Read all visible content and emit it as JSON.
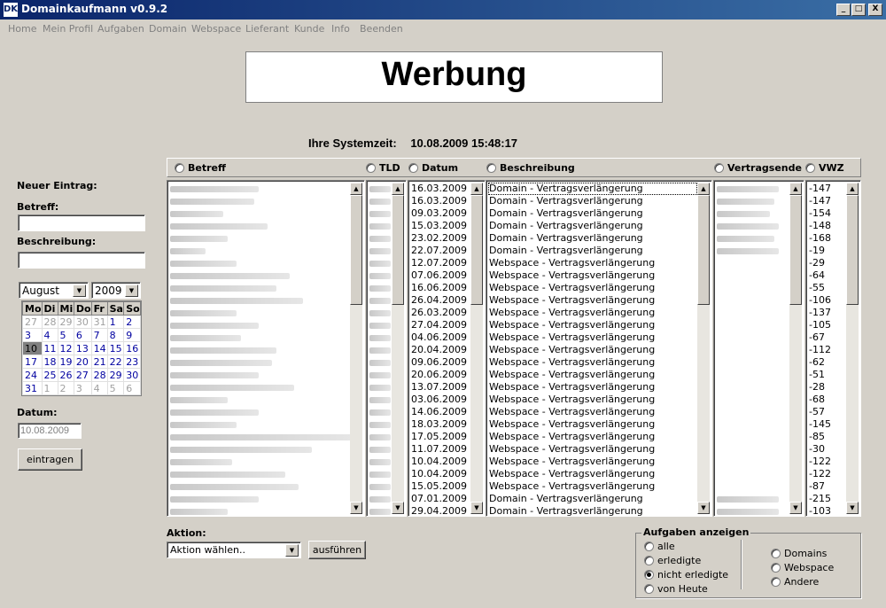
{
  "window": {
    "app_icon": "DK",
    "title": "Domainkaufmann v0.9.2",
    "minimize_glyph": "_",
    "maximize_glyph": "□",
    "close_glyph": "X"
  },
  "menu": [
    "Home",
    "Mein Profil",
    "Aufgaben",
    "Domain",
    "Webspace",
    "Lieferant",
    "Kunde",
    "Info",
    "Beenden"
  ],
  "ad": {
    "text": "Werbung"
  },
  "system_time": {
    "label": "Ihre Systemzeit:",
    "value": "10.08.2009 15:48:17"
  },
  "new_entry": {
    "heading": "Neuer Eintrag:",
    "betreff_label": "Betreff:",
    "betreff_value": "",
    "beschreibung_label": "Beschreibung:",
    "beschreibung_value": "",
    "month": "August",
    "year": "2009",
    "datum_label": "Datum:",
    "datum_value": "10.08.2009",
    "submit_label": "eintragen"
  },
  "calendar": {
    "weekdays": [
      "Mo",
      "Di",
      "Mi",
      "Do",
      "Fr",
      "Sa",
      "So"
    ],
    "weeks": [
      [
        {
          "d": "27",
          "t": "other"
        },
        {
          "d": "28",
          "t": "other"
        },
        {
          "d": "29",
          "t": "other"
        },
        {
          "d": "30",
          "t": "other"
        },
        {
          "d": "31",
          "t": "other"
        },
        {
          "d": "1",
          "t": "cur"
        },
        {
          "d": "2",
          "t": "cur"
        }
      ],
      [
        {
          "d": "3",
          "t": "cur"
        },
        {
          "d": "4",
          "t": "cur"
        },
        {
          "d": "5",
          "t": "cur"
        },
        {
          "d": "6",
          "t": "cur"
        },
        {
          "d": "7",
          "t": "cur"
        },
        {
          "d": "8",
          "t": "cur"
        },
        {
          "d": "9",
          "t": "cur"
        }
      ],
      [
        {
          "d": "10",
          "t": "today"
        },
        {
          "d": "11",
          "t": "cur"
        },
        {
          "d": "12",
          "t": "cur"
        },
        {
          "d": "13",
          "t": "cur"
        },
        {
          "d": "14",
          "t": "cur"
        },
        {
          "d": "15",
          "t": "cur"
        },
        {
          "d": "16",
          "t": "cur"
        }
      ],
      [
        {
          "d": "17",
          "t": "cur"
        },
        {
          "d": "18",
          "t": "cur"
        },
        {
          "d": "19",
          "t": "cur"
        },
        {
          "d": "20",
          "t": "cur"
        },
        {
          "d": "21",
          "t": "cur"
        },
        {
          "d": "22",
          "t": "cur"
        },
        {
          "d": "23",
          "t": "cur"
        }
      ],
      [
        {
          "d": "24",
          "t": "cur"
        },
        {
          "d": "25",
          "t": "cur"
        },
        {
          "d": "26",
          "t": "cur"
        },
        {
          "d": "27",
          "t": "cur"
        },
        {
          "d": "28",
          "t": "cur"
        },
        {
          "d": "29",
          "t": "cur"
        },
        {
          "d": "30",
          "t": "cur"
        }
      ],
      [
        {
          "d": "31",
          "t": "cur"
        },
        {
          "d": "1",
          "t": "other"
        },
        {
          "d": "2",
          "t": "other"
        },
        {
          "d": "3",
          "t": "other"
        },
        {
          "d": "4",
          "t": "other"
        },
        {
          "d": "5",
          "t": "other"
        },
        {
          "d": "6",
          "t": "other"
        }
      ]
    ]
  },
  "columns": {
    "betreff": "Betreff",
    "tld": "TLD",
    "datum": "Datum",
    "beschreibung": "Beschreibung",
    "vertragsende": "Vertragsende",
    "vwz": "VWZ"
  },
  "scroll_glyphs": {
    "up": "▲",
    "down": "▼"
  },
  "tasks": [
    {
      "datum": "16.03.2009",
      "beschreibung": "Domain - Vertragsverlängerung",
      "vwz": "-147"
    },
    {
      "datum": "16.03.2009",
      "beschreibung": "Domain - Vertragsverlängerung",
      "vwz": "-147"
    },
    {
      "datum": "09.03.2009",
      "beschreibung": "Domain - Vertragsverlängerung",
      "vwz": "-154"
    },
    {
      "datum": "15.03.2009",
      "beschreibung": "Domain - Vertragsverlängerung",
      "vwz": "-148"
    },
    {
      "datum": "23.02.2009",
      "beschreibung": "Domain - Vertragsverlängerung",
      "vwz": "-168"
    },
    {
      "datum": "22.07.2009",
      "beschreibung": "Domain - Vertragsverlängerung",
      "vwz": "-19"
    },
    {
      "datum": "12.07.2009",
      "beschreibung": "Webspace - Vertragsverlängerung",
      "vwz": "-29"
    },
    {
      "datum": "07.06.2009",
      "beschreibung": "Webspace - Vertragsverlängerung",
      "vwz": "-64"
    },
    {
      "datum": "16.06.2009",
      "beschreibung": "Webspace - Vertragsverlängerung",
      "vwz": "-55"
    },
    {
      "datum": "26.04.2009",
      "beschreibung": "Webspace - Vertragsverlängerung",
      "vwz": "-106"
    },
    {
      "datum": "26.03.2009",
      "beschreibung": "Webspace - Vertragsverlängerung",
      "vwz": "-137"
    },
    {
      "datum": "27.04.2009",
      "beschreibung": "Webspace - Vertragsverlängerung",
      "vwz": "-105"
    },
    {
      "datum": "04.06.2009",
      "beschreibung": "Webspace - Vertragsverlängerung",
      "vwz": "-67"
    },
    {
      "datum": "20.04.2009",
      "beschreibung": "Webspace - Vertragsverlängerung",
      "vwz": "-112"
    },
    {
      "datum": "09.06.2009",
      "beschreibung": "Webspace - Vertragsverlängerung",
      "vwz": "-62"
    },
    {
      "datum": "20.06.2009",
      "beschreibung": "Webspace - Vertragsverlängerung",
      "vwz": "-51"
    },
    {
      "datum": "13.07.2009",
      "beschreibung": "Webspace - Vertragsverlängerung",
      "vwz": "-28"
    },
    {
      "datum": "03.06.2009",
      "beschreibung": "Webspace - Vertragsverlängerung",
      "vwz": "-68"
    },
    {
      "datum": "14.06.2009",
      "beschreibung": "Webspace - Vertragsverlängerung",
      "vwz": "-57"
    },
    {
      "datum": "18.03.2009",
      "beschreibung": "Webspace - Vertragsverlängerung",
      "vwz": "-145"
    },
    {
      "datum": "17.05.2009",
      "beschreibung": "Webspace - Vertragsverlängerung",
      "vwz": "-85"
    },
    {
      "datum": "11.07.2009",
      "beschreibung": "Webspace - Vertragsverlängerung",
      "vwz": "-30"
    },
    {
      "datum": "10.04.2009",
      "beschreibung": "Webspace - Vertragsverlängerung",
      "vwz": "-122"
    },
    {
      "datum": "10.04.2009",
      "beschreibung": "Webspace - Vertragsverlängerung",
      "vwz": "-122"
    },
    {
      "datum": "15.05.2009",
      "beschreibung": "Webspace - Vertragsverlängerung",
      "vwz": "-87"
    },
    {
      "datum": "07.01.2009",
      "beschreibung": "Domain - Vertragsverlängerung",
      "vwz": "-215"
    },
    {
      "datum": "29.04.2009",
      "beschreibung": "Domain - Vertragsverlängerung",
      "vwz": "-103"
    }
  ],
  "action": {
    "label": "Aktion:",
    "select_value": "Aktion wählen..",
    "button_label": "ausführen"
  },
  "aufgaben_anzeigen": {
    "title": "Aufgaben anzeigen",
    "filters": [
      {
        "label": "alle",
        "selected": false
      },
      {
        "label": "erledigte",
        "selected": false
      },
      {
        "label": "nicht erledigte",
        "selected": true
      },
      {
        "label": "von Heute",
        "selected": false
      }
    ],
    "types": [
      {
        "label": "Domains",
        "selected": false
      },
      {
        "label": "Webspace",
        "selected": false
      },
      {
        "label": "Andere",
        "selected": false
      }
    ]
  }
}
